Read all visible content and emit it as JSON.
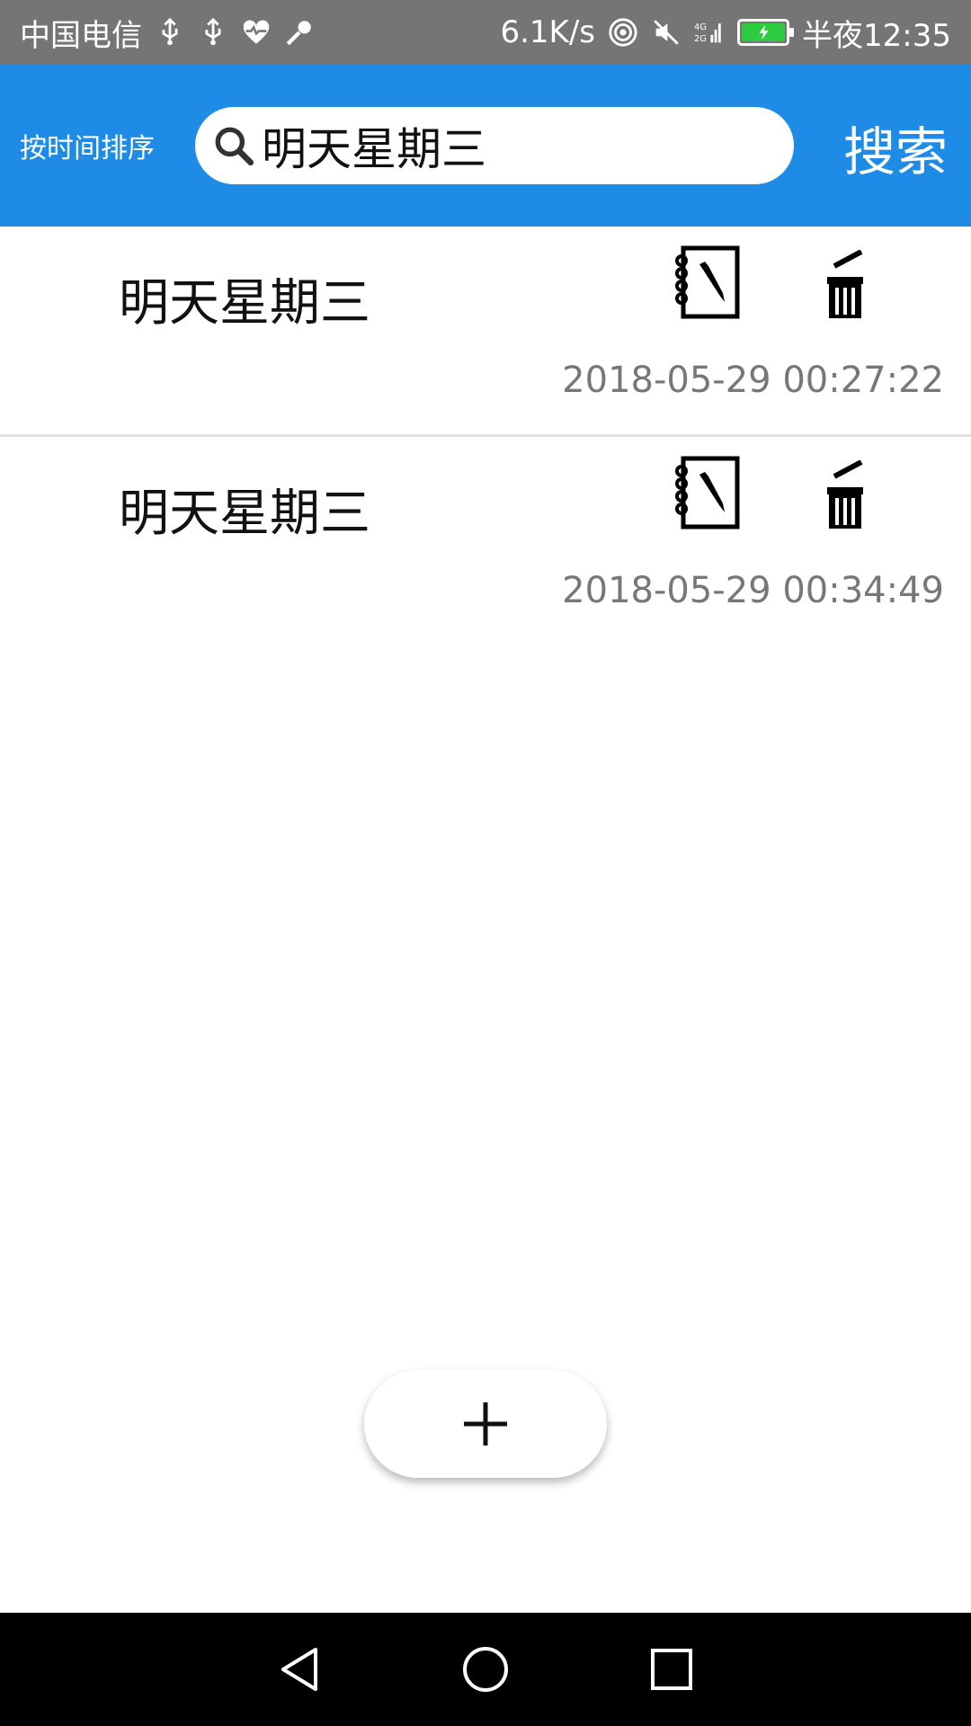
{
  "status_bar": {
    "carrier": "中国电信",
    "speed": "6.1K/s",
    "network": "4G 2G",
    "time": "半夜12:35",
    "icons": [
      "usb-icon",
      "usb-icon",
      "heart-rate-icon",
      "key-icon",
      "hotspot-icon",
      "mute-icon",
      "signal-icon",
      "battery-icon"
    ]
  },
  "app_bar": {
    "sort_label": "按时间排序",
    "search_value": "明天星期三",
    "search_button": "搜索",
    "color": "#1e8be6"
  },
  "notes": [
    {
      "title": "明天星期三",
      "time": "2018-05-29 00:27:22"
    },
    {
      "title": "明天星期三",
      "time": "2018-05-29 00:34:49"
    }
  ],
  "fab": {
    "icon": "plus-icon"
  },
  "nav": {
    "back": "back-icon",
    "home": "home-icon",
    "recents": "recents-icon"
  }
}
